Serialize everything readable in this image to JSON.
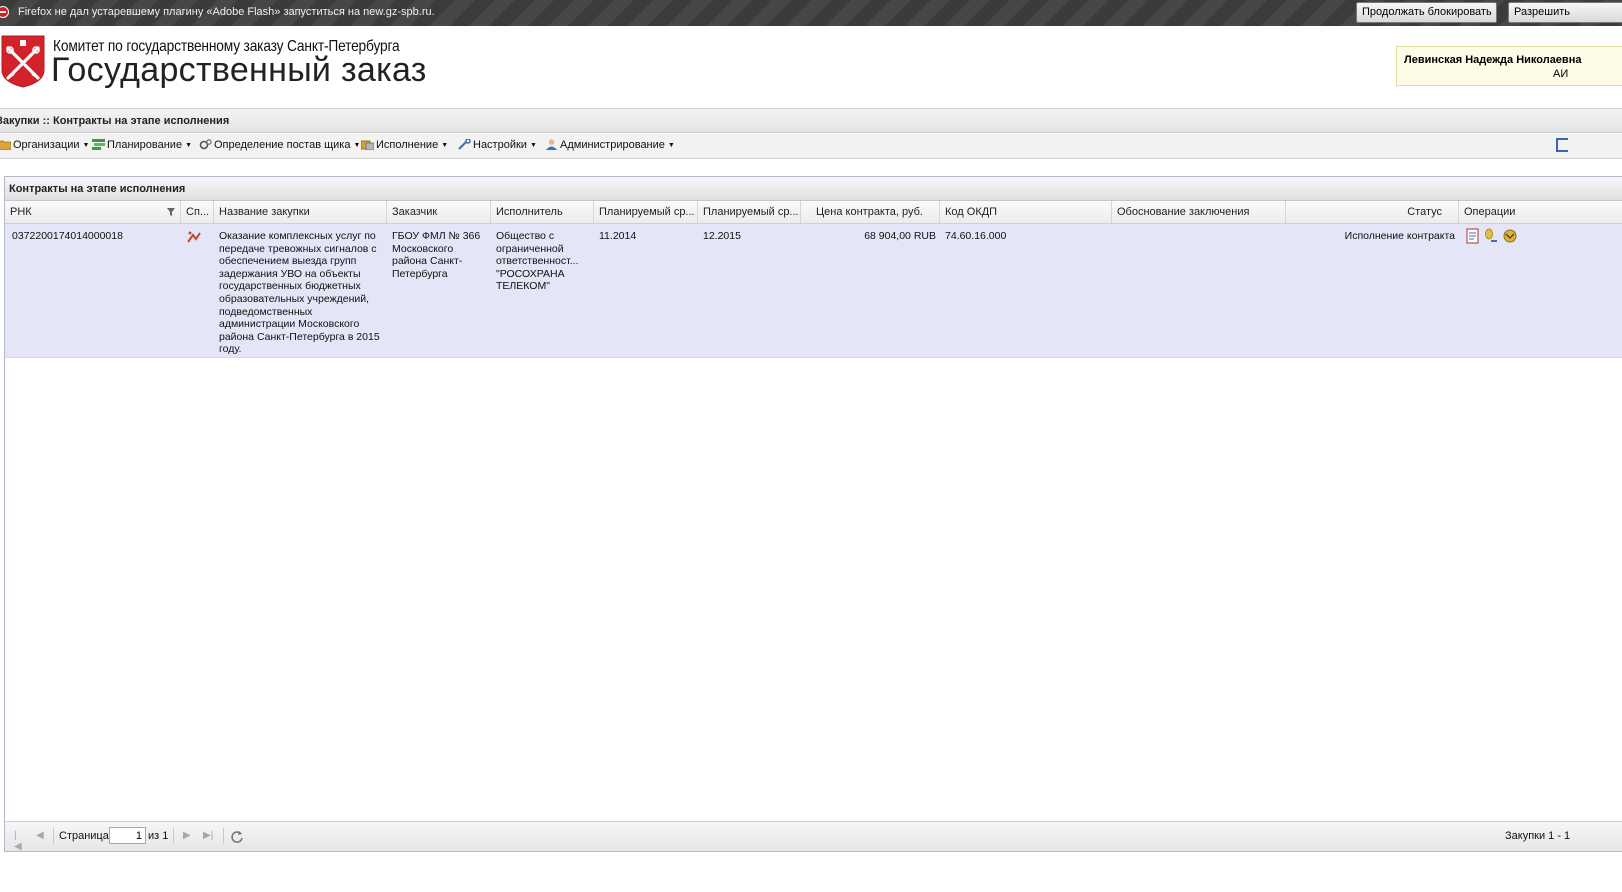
{
  "notification": {
    "message": "Firefox не дал устаревшему плагину «Adobe Flash» запуститься на new.gz-spb.ru.",
    "keep_blocking": "Продолжать блокировать",
    "allow": "Разрешить"
  },
  "header": {
    "brand_line1": "Комитет по государственному заказу Санкт-Петербурга",
    "brand_line2": "Государственный заказ",
    "user_name": "Левинская Надежда Николаевна",
    "user_role": "АИ"
  },
  "breadcrumb": "Закупки :: Контракты на этапе исполнения",
  "menu": [
    {
      "label": "Организации",
      "icon": "folder-icon"
    },
    {
      "label": "Планирование",
      "icon": "plan-icon"
    },
    {
      "label": "Определение постав щика",
      "icon": "gears-icon"
    },
    {
      "label": "Исполнение",
      "icon": "execution-icon"
    },
    {
      "label": "Настройки",
      "icon": "wrench-icon"
    },
    {
      "label": "Администрирование",
      "icon": "user-icon"
    }
  ],
  "panel": {
    "title": "Контракты на этапе исполнения",
    "columns": [
      "РНК",
      "Сп...",
      "Название закупки",
      "Заказчик",
      "Исполнитель",
      "Планируемый ср...",
      "Планируемый ср...",
      "Цена контракта, руб.",
      "Код ОКДП",
      "Обоснование заключения",
      "Статус",
      "Операции"
    ],
    "rows": [
      {
        "rnk": "0372200174014000018",
        "method_icon": "method-icon",
        "name": "Оказание комплексных услуг по передаче тревожных сигналов с обеспечением выезда групп задержания УВО на объекты государственных бюджетных образовательных учреждений, подведомственных администрации Московского района Санкт-Петербурга в 2015 году.",
        "customer": "ГБОУ ФМЛ № 366 Московского района Санкт-Петербурга",
        "supplier": "Общество с ограниченной ответственност... \"РОСОХРАНА ТЕЛЕКОМ\"",
        "plan_start": "11.2014",
        "plan_end": "12.2015",
        "price": "68 904,00 RUB",
        "okdp": "74.60.16.000",
        "basis": "",
        "status": "Исполнение контракта",
        "operations": [
          "document-icon",
          "edit-icon",
          "emblem-icon"
        ]
      }
    ]
  },
  "pager": {
    "page_label": "Страница",
    "page_value": "1",
    "of_label": "из 1",
    "summary": "Закупки 1 - 1"
  }
}
